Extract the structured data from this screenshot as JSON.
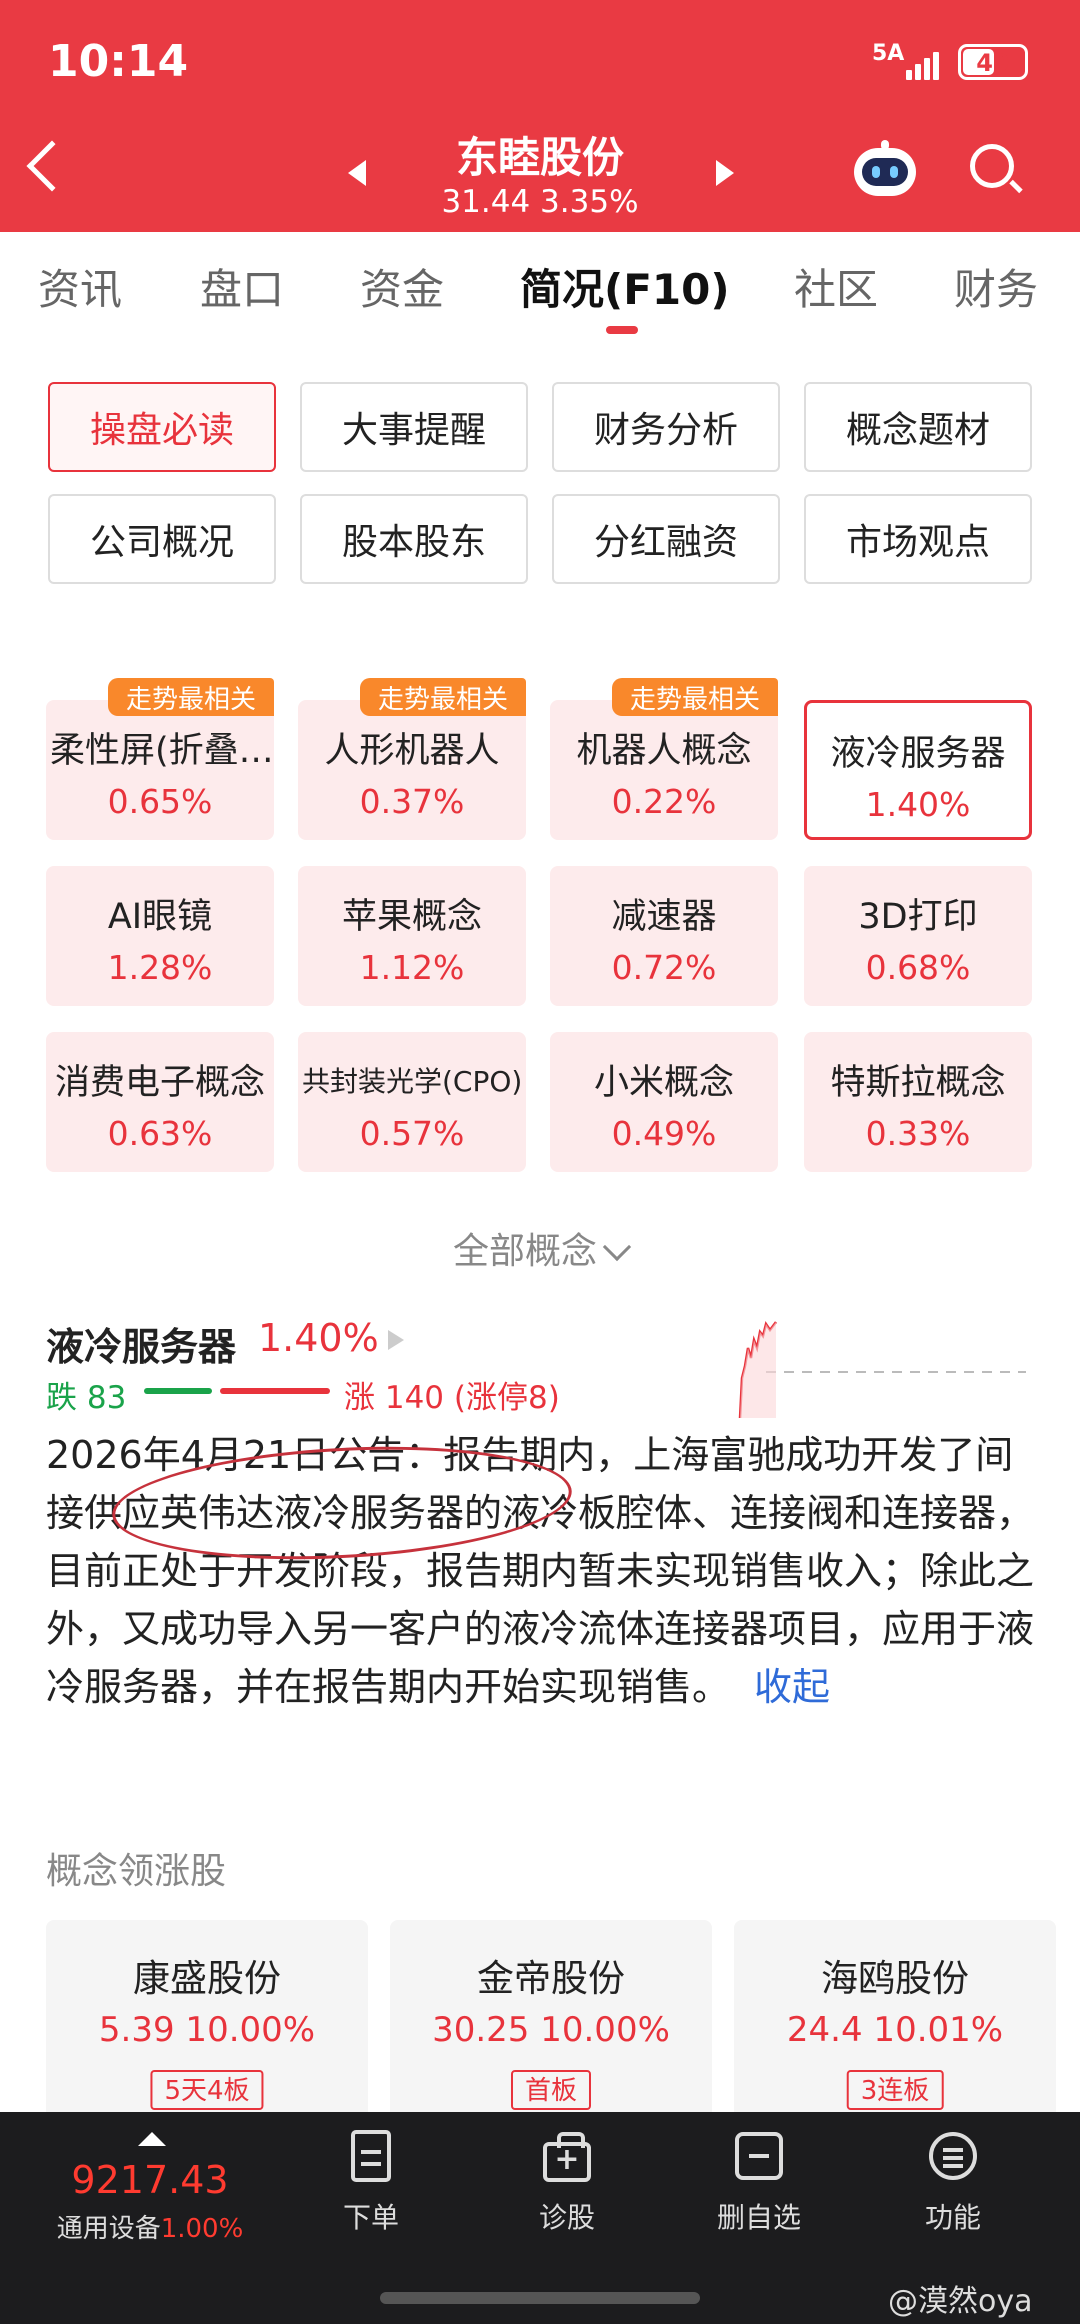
{
  "status_bar": {
    "time": "10:14",
    "network": "5A",
    "battery": "49",
    "battery_level": 0.49
  },
  "header": {
    "stock_name": "东睦股份",
    "price_line": "31.44  3.35%"
  },
  "tabs": [
    "资讯",
    "盘口",
    "资金",
    "简况(F10)",
    "社区",
    "财务"
  ],
  "active_tab": "简况(F10)",
  "sub_buttons": [
    "操盘必读",
    "大事提醒",
    "财务分析",
    "概念题材",
    "公司概况",
    "股本股东",
    "分红融资",
    "市场观点"
  ],
  "concepts": [
    {
      "name": "柔性屏(折叠…",
      "pct": "0.65%",
      "tag": "走势最相关"
    },
    {
      "name": "人形机器人",
      "pct": "0.37%",
      "tag": "走势最相关"
    },
    {
      "name": "机器人概念",
      "pct": "0.22%",
      "tag": "走势最相关"
    },
    {
      "name": "液冷服务器",
      "pct": "1.40%",
      "tag": ""
    },
    {
      "name": "AI眼镜",
      "pct": "1.28%",
      "tag": ""
    },
    {
      "name": "苹果概念",
      "pct": "1.12%",
      "tag": ""
    },
    {
      "name": "减速器",
      "pct": "0.72%",
      "tag": ""
    },
    {
      "name": "3D打印",
      "pct": "0.68%",
      "tag": ""
    },
    {
      "name": "消费电子概念",
      "pct": "0.63%",
      "tag": ""
    },
    {
      "name": "共封装光学(CPO)",
      "pct": "0.57%",
      "tag": ""
    },
    {
      "name": "小米概念",
      "pct": "0.49%",
      "tag": ""
    },
    {
      "name": "特斯拉概念",
      "pct": "0.33%",
      "tag": ""
    }
  ],
  "all_concepts_label": "全部概念",
  "detail": {
    "title": "液冷服务器",
    "pct": "1.40%",
    "fall": "跌 83",
    "rise": "涨 140 (涨停8)",
    "desc": "2026年4月21日公告：报告期内，上海富驰成功开发了间接供应英伟达液冷服务器的液冷板腔体、连接阀和连接器，目前正处于开发阶段，报告期内暂未实现销售收入；除此之外，又成功导入另一客户的液冷流体连接器项目，应用于液冷服务器，并在报告期内开始实现销售。",
    "collapse": "收起"
  },
  "leaders_title": "概念领涨股",
  "leaders": [
    {
      "name": "康盛股份",
      "value": "5.39 10.00%",
      "badge": "5天4板"
    },
    {
      "name": "金帝股份",
      "value": "30.25 10.00%",
      "badge": "首板"
    },
    {
      "name": "海鸥股份",
      "value": "24.4 10.01%",
      "badge": "3连板"
    }
  ],
  "bottom_bar": {
    "index_value": "9217.43",
    "index_name": "通用设备",
    "index_pct": "1.00%",
    "items": [
      "下单",
      "诊股",
      "删自选",
      "功能"
    ]
  },
  "watermark": "@漠然oya",
  "colors": {
    "brand_red": "#e93a43",
    "up_red": "#e8333c",
    "down_green": "#1aa34a",
    "tag_orange": "#f9882b",
    "link_blue": "#2f6bd8"
  }
}
